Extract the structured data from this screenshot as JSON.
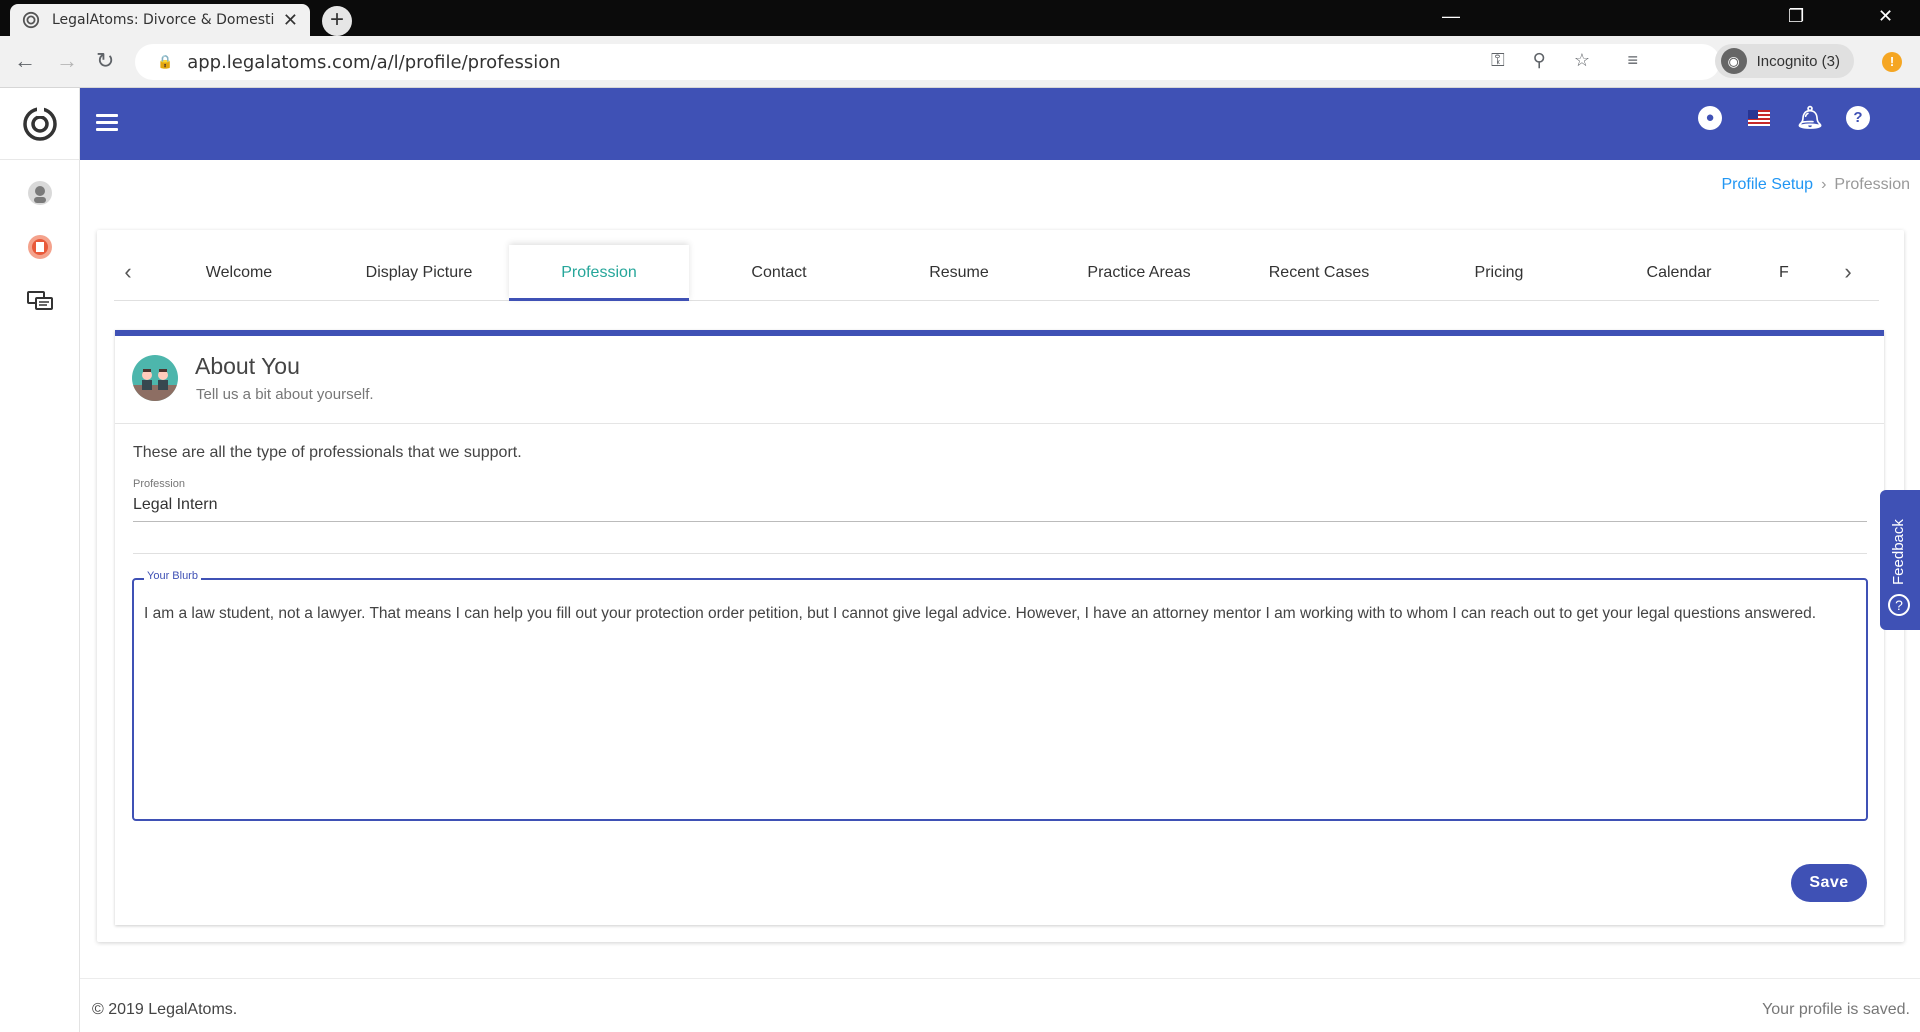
{
  "browser": {
    "tab_title": "LegalAtoms: Divorce & Domestic",
    "url": "app.legalatoms.com/a/l/profile/profession",
    "incognito_label": "Incognito (3)"
  },
  "breadcrumb": {
    "parent": "Profile Setup",
    "separator": "›",
    "current": "Profession"
  },
  "tabs": [
    "Welcome",
    "Display Picture",
    "Profession",
    "Contact",
    "Resume",
    "Practice Areas",
    "Recent Cases",
    "Pricing",
    "Calendar",
    "F"
  ],
  "active_tab": "Profession",
  "about": {
    "title": "About You",
    "subtitle": "Tell us a bit about yourself.",
    "support_text": "These are all the type of professionals that we support.",
    "profession_label": "Profession",
    "profession_value": "Legal Intern",
    "blurb_label": "Your Blurb",
    "blurb_text": "I am a law student, not a lawyer. That means I can help you fill out your protection order petition, but I cannot give legal advice. However, I have an attorney mentor I am working with to whom I can reach out to get your legal questions answered.",
    "save_label": "Save"
  },
  "feedback_label": "Feedback",
  "footer": {
    "copyright": "© 2019 LegalAtoms.",
    "status": "Your profile is saved."
  },
  "colors": {
    "primary": "#3f51b5",
    "active_tab_text": "#26a69a",
    "link": "#2196f3"
  }
}
